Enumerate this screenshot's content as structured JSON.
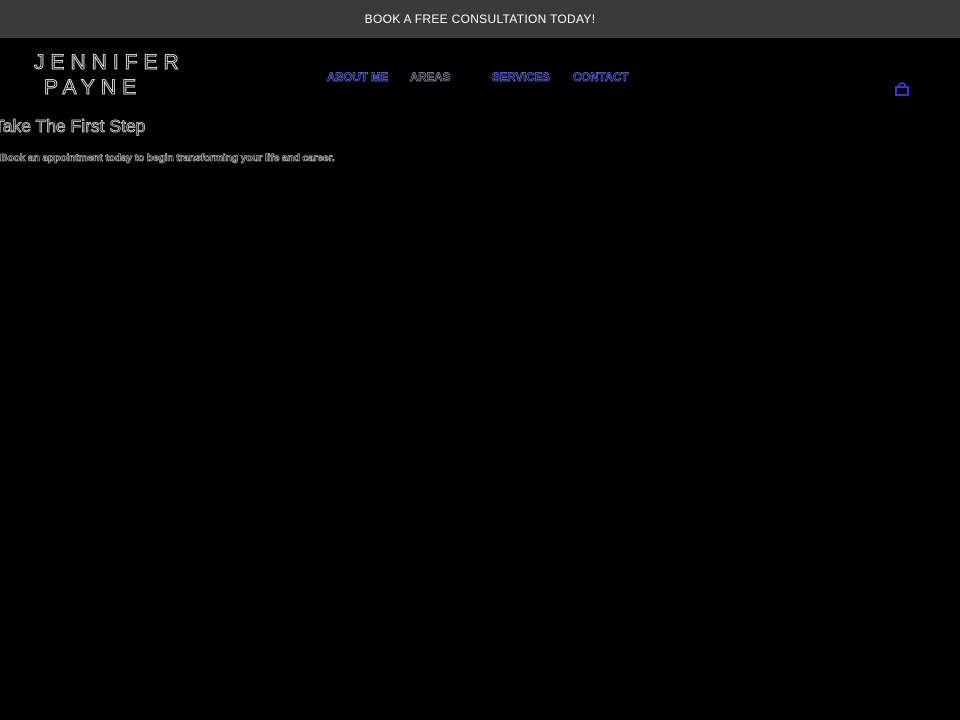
{
  "announcement": {
    "text": "BOOK A FREE CONSULTATION TODAY!"
  },
  "logo": {
    "line1": "JENNIFER",
    "line2": "PAYNE"
  },
  "nav": {
    "items": [
      {
        "label": "ABOUT ME"
      },
      {
        "label": "AREAS"
      },
      {
        "label": "SERVICES"
      },
      {
        "label": "CONTACT"
      }
    ]
  },
  "header": {
    "cart_icon": "cart-icon"
  },
  "hero": {
    "heading": "Take The First Step",
    "text": "Book an appointment today to begin transforming your life and career."
  },
  "colors": {
    "background": "#000000",
    "announcement_bg": "#3a3a3a",
    "announcement_text": "#ffffff",
    "nav_link": "#6a6cf2",
    "nav_link_muted": "#8d8da8",
    "cart_icon": "#2f35e0",
    "heading_outline": "#d8d8d8"
  }
}
